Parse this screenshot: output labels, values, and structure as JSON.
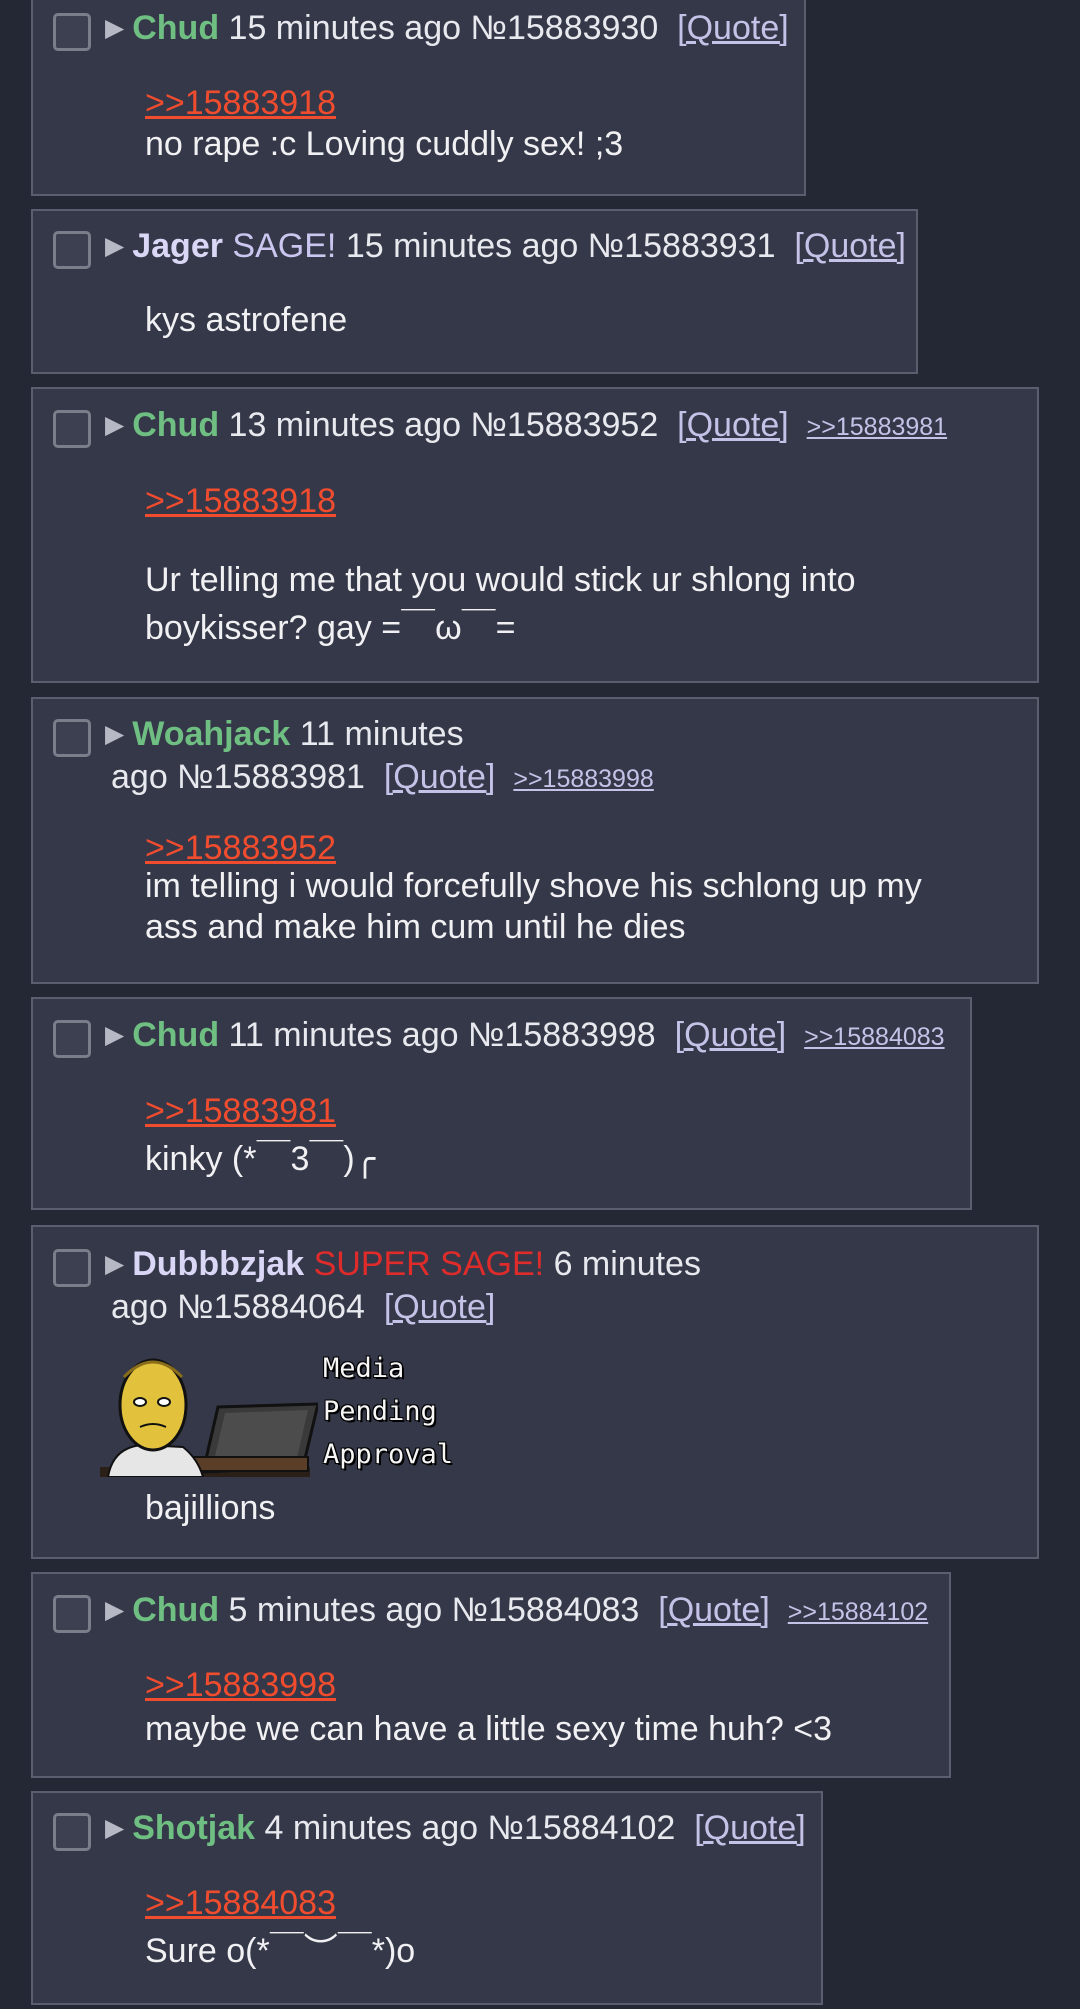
{
  "posts": [
    {
      "name": "Chud",
      "time": "15 minutes ago",
      "no": "№15883930",
      "quote_label": "[Quote]",
      "reply_ref": ">>15883918",
      "body": "no rape :c Loving cuddly sex! ;3"
    },
    {
      "name": "Jager",
      "sage": "SAGE!",
      "time": "15 minutes ago",
      "no": "№15883931",
      "quote_label": "[Quote]",
      "body": "kys astrofene"
    },
    {
      "name": "Chud",
      "time": "13 minutes ago",
      "no": "№15883952",
      "quote_label": "[Quote]",
      "backlink": ">>15883981",
      "reply_ref": ">>15883918",
      "body": "Ur telling me that you would stick ur shlong into boykisser? gay =￣ω￣="
    },
    {
      "name": "Woahjack",
      "time_part1": "11 minutes",
      "time_part2": "ago №15883981",
      "quote_label": "[Quote]",
      "backlink": ">>15883998",
      "reply_ref": ">>15883952",
      "body": "im telling i would forcefully shove his schlong up my ass and make him cum until he dies"
    },
    {
      "name": "Chud",
      "time": "11 minutes ago",
      "no": "№15883998",
      "quote_label": "[Quote]",
      "backlink": ">>15884083",
      "reply_ref": ">>15883981",
      "body": "kinky (*￣3￣)╭"
    },
    {
      "name": "Dubbbzjak",
      "supersage": "SUPER SAGE!",
      "time_part1": "6 minutes",
      "time_part2": "ago №15884064",
      "quote_label": "[Quote]",
      "media_lines": [
        "Media",
        "Pending",
        "Approval"
      ],
      "body": "bajillions"
    },
    {
      "name": "Chud",
      "time": "5 minutes ago",
      "no": "№15884083",
      "quote_label": "[Quote]",
      "backlink": ">>15884102",
      "reply_ref": ">>15883998",
      "body": "maybe we can have a little sexy time huh? <3"
    },
    {
      "name": "Shotjak",
      "time": "4 minutes ago",
      "no": "№15884102",
      "quote_label": "[Quote]",
      "reply_ref": ">>15884083",
      "body": "Sure o(*￣︶￣*)o"
    }
  ],
  "icons": {
    "expand": "triangle-right-icon",
    "select": "checkbox"
  },
  "colors": {
    "background": "#242834",
    "post": "#353848",
    "name_green": "#6fbf83",
    "name_lavender": "#d9d6f6",
    "reply_ref": "#f24c2f",
    "super_sage": "#e02b2b"
  }
}
